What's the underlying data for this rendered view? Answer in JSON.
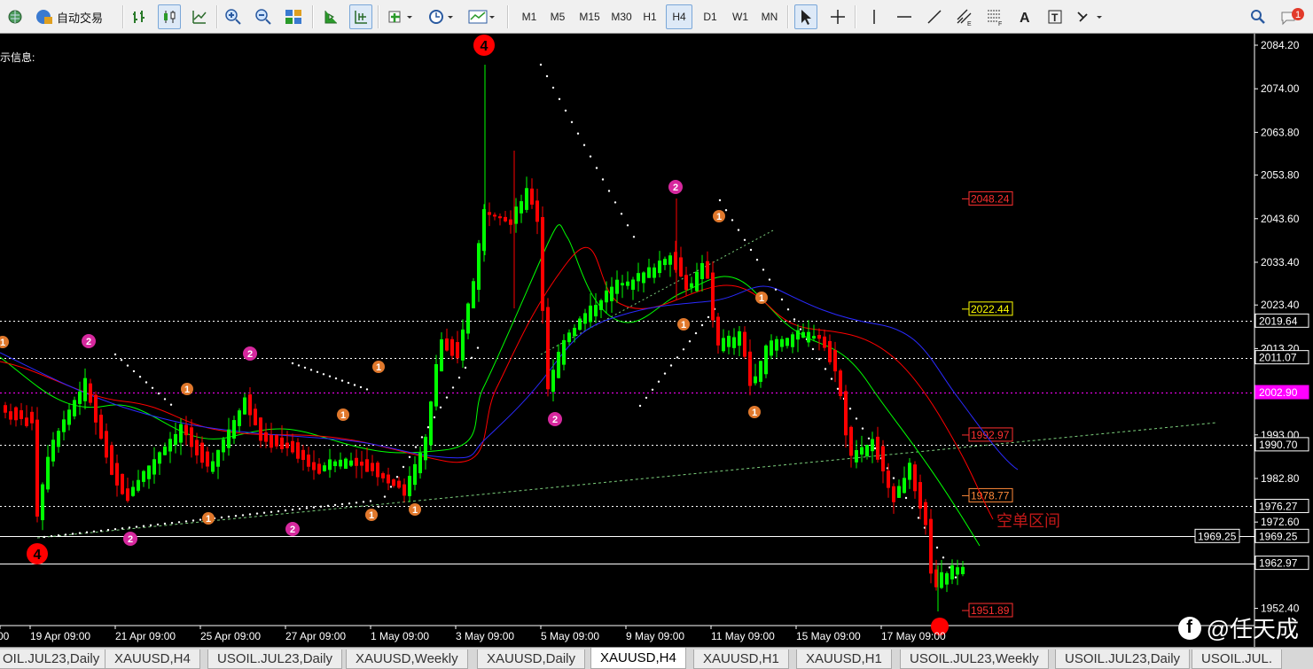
{
  "toolbar": {
    "autotrade_label": "自动交易",
    "timeframes": [
      "M1",
      "M5",
      "M15",
      "M30",
      "H1",
      "H4",
      "D1",
      "W1",
      "MN"
    ],
    "active_timeframe": "H4",
    "notification_count": "1",
    "icons": [
      "globe-icon",
      "autotrade-icon",
      "bar-chart-icon",
      "candlestick-icon",
      "line-chart-icon",
      "zoom-in-icon",
      "zoom-out-icon",
      "tile-windows-icon",
      "chart-shift-icon",
      "autoscroll-icon",
      "add-indicator-icon",
      "periods-icon",
      "templates-icon",
      "cursor-icon",
      "crosshair-icon",
      "vertical-line-icon",
      "horizontal-line-icon",
      "trendline-icon",
      "channel-icon",
      "fibonacci-icon",
      "text-icon",
      "text-label-icon",
      "shapes-icon",
      "search-icon",
      "notifications-icon"
    ]
  },
  "chart": {
    "info_label": "示信息:",
    "symbol": "XAUUSD,H4",
    "zone_label": "空单区间",
    "price_ticks": [
      "2084.20",
      "2074.00",
      "2063.80",
      "2053.80",
      "2043.60",
      "2033.40",
      "2023.40",
      "2013.20",
      "2003.20",
      "1993.00",
      "1982.80",
      "1972.60",
      "1962.60",
      "1952.40"
    ],
    "time_labels": [
      "00",
      "19 Apr 09:00",
      "21 Apr 09:00",
      "25 Apr 09:00",
      "27 Apr 09:00",
      "1 May 09:00",
      "3 May 09:00",
      "5 May 09:00",
      "9 May 09:00",
      "11 May 09:00",
      "15 May 09:00",
      "17 May 09:00"
    ],
    "level_lines": [
      {
        "price": "2019.64",
        "color": "#ffffff",
        "style": "dotted"
      },
      {
        "price": "2011.07",
        "color": "#ffffff",
        "style": "dotted"
      },
      {
        "price": "2002.90",
        "color": "#ff00ff",
        "style": "dotted"
      },
      {
        "price": "1990.70",
        "color": "#ffffff",
        "style": "dotted"
      },
      {
        "price": "1976.27",
        "color": "#ffffff",
        "style": "dotted"
      },
      {
        "price": "1969.25",
        "color": "#ffffff",
        "style": "solid"
      },
      {
        "price": "1962.97",
        "color": "#ffffff",
        "style": "solid"
      }
    ],
    "right_labels": [
      {
        "text": "2048.24",
        "color": "#ff3030"
      },
      {
        "text": "2022.44",
        "color": "#ffff00"
      },
      {
        "text": "1992.97",
        "color": "#ff3030"
      },
      {
        "text": "1978.77",
        "color": "#ff8a3a"
      },
      {
        "text": "1951.89",
        "color": "#ff3030"
      }
    ],
    "wave_labels": [
      "4",
      "4",
      "2",
      "2",
      "2",
      "2",
      "2",
      "2",
      "1",
      "1",
      "1",
      "1",
      "1",
      "1",
      "1",
      "1",
      "1"
    ],
    "colors": {
      "bull": "#00ff00",
      "bear": "#ff0000",
      "ma_fast": "#00ff00",
      "ma_mid": "#ff0000",
      "ma_slow": "#2a2aff",
      "sar": "#ffffff",
      "trend": "#7ccf7c"
    }
  },
  "tabs": [
    "OIL.JUL23,Daily",
    "XAUUSD,H4",
    "USOIL.JUL23,Daily",
    "XAUUSD,Weekly",
    "XAUUSD,Daily",
    "XAUUSD,H4",
    "XAUUSD,H1",
    "XAUUSD,H1",
    "USOIL.JUL23,Weekly",
    "USOIL.JUL23,Daily",
    "USOIL.JUL."
  ],
  "active_tab": "XAUUSD,H4",
  "watermark": {
    "text": "@任天成"
  }
}
